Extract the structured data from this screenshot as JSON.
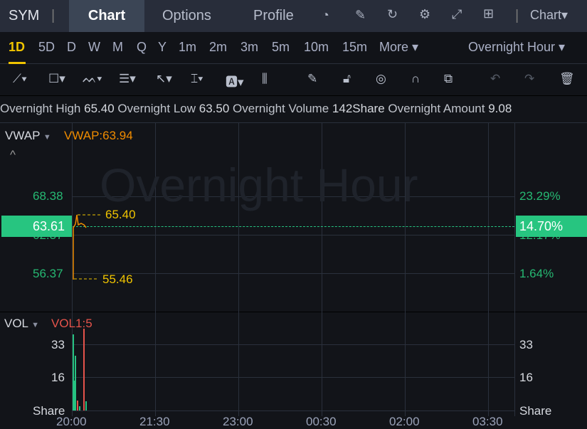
{
  "header": {
    "symbol": "SYM",
    "tabs": [
      "Chart",
      "Options",
      "Profile"
    ],
    "chart_menu": "Chart▾"
  },
  "periods": {
    "items": [
      "1D",
      "5D",
      "D",
      "W",
      "M",
      "Q",
      "Y",
      "1m",
      "2m",
      "3m",
      "5m",
      "10m",
      "15m",
      "More ▾"
    ],
    "active": "1D",
    "session": "Overnight Hour ▾"
  },
  "info": {
    "high_label": "Overnight High",
    "high": "65.40",
    "low_label": "Overnight Low",
    "low": "63.50",
    "volume_label": "Overnight Volume",
    "volume": "142Share",
    "amount_label": "Overnight Amount",
    "amount": "9.08"
  },
  "main": {
    "indicator": "VWAP",
    "indicator_value": "VWAP:63.94",
    "watermark": "Overnight Hour",
    "y_left": [
      "68.38",
      "62.37",
      "56.37"
    ],
    "y_right": [
      "23.29%",
      "12.17%",
      "1.64%"
    ],
    "current_price": "63.61",
    "current_pct": "14.70%",
    "high_mark": "65.40",
    "low_mark": "55.46"
  },
  "vol": {
    "indicator": "VOL",
    "indicator_value": "VOL1:5",
    "y_left": [
      "33",
      "16",
      "Share"
    ],
    "y_right": [
      "33",
      "16",
      "Share"
    ]
  },
  "x_axis": [
    "20:00",
    "21:30",
    "23:00",
    "00:30",
    "02:00",
    "03:30"
  ],
  "colors": {
    "up": "#26c281",
    "down": "#e5534b",
    "accent": "#f0c400"
  }
}
